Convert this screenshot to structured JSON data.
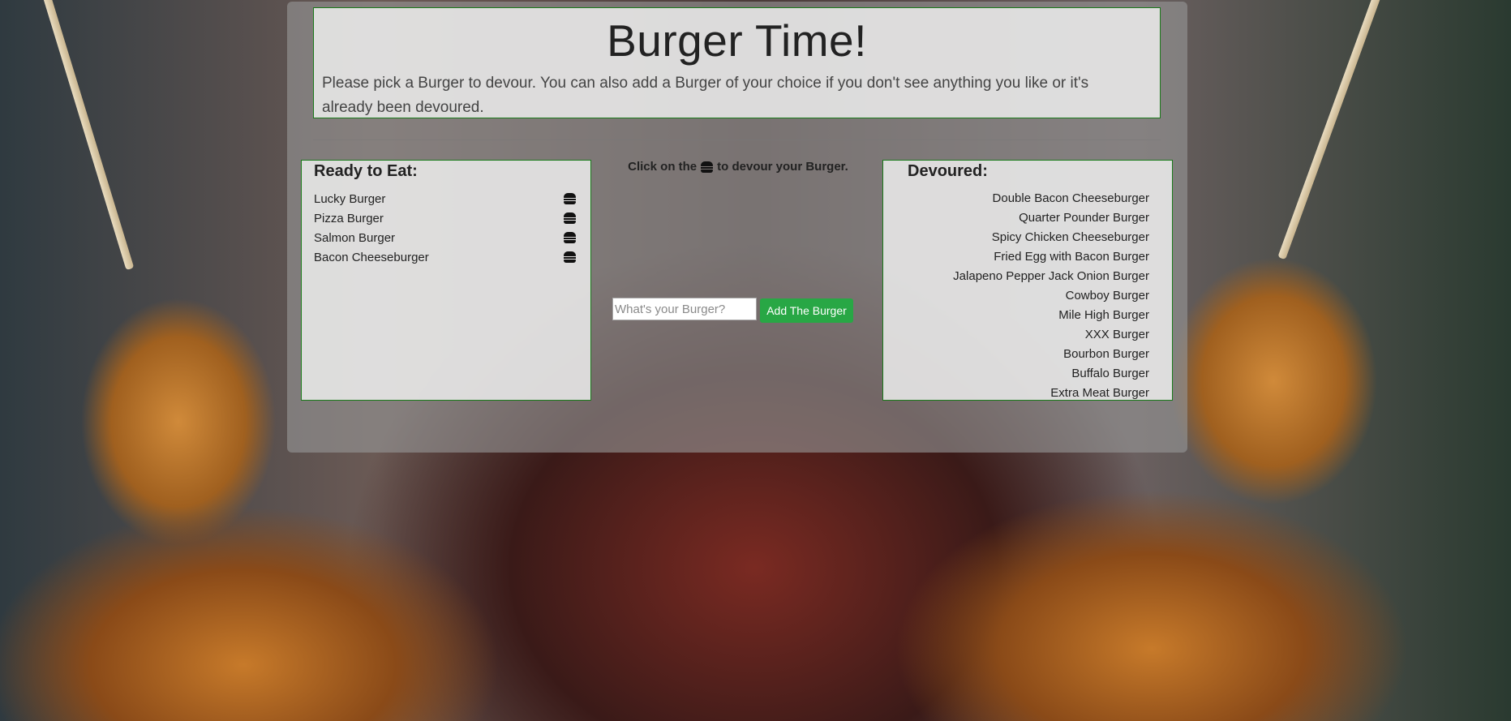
{
  "header": {
    "title": "Burger Time!",
    "lead": "Please pick a Burger to devour. You can also add a Burger of your choice if you don't see anything you like or it's already been devoured."
  },
  "ready": {
    "heading": "Ready to Eat:",
    "items": [
      "Lucky Burger",
      "Pizza Burger",
      "Salmon Burger",
      "Bacon Cheeseburger"
    ],
    "icon": "hamburger-icon"
  },
  "instructions": {
    "before": "Click on the",
    "after": "to devour your Burger.",
    "icon": "hamburger-icon"
  },
  "form": {
    "placeholder": "What's your Burger?",
    "value": "",
    "button_label": "Add The Burger",
    "button_color": "#28a745"
  },
  "devoured": {
    "heading": "Devoured:",
    "items": [
      "Double Bacon Cheeseburger",
      "Quarter Pounder Burger",
      "Spicy Chicken Cheeseburger",
      "Fried Egg with Bacon Burger",
      "Jalapeno Pepper Jack Onion Burger",
      "Cowboy Burger",
      "Mile High Burger",
      "XXX Burger",
      "Bourbon Burger",
      "Buffalo Burger",
      "Extra Meat Burger"
    ]
  },
  "colors": {
    "box_border": "#1a7a1a",
    "accent": "#28a745"
  }
}
